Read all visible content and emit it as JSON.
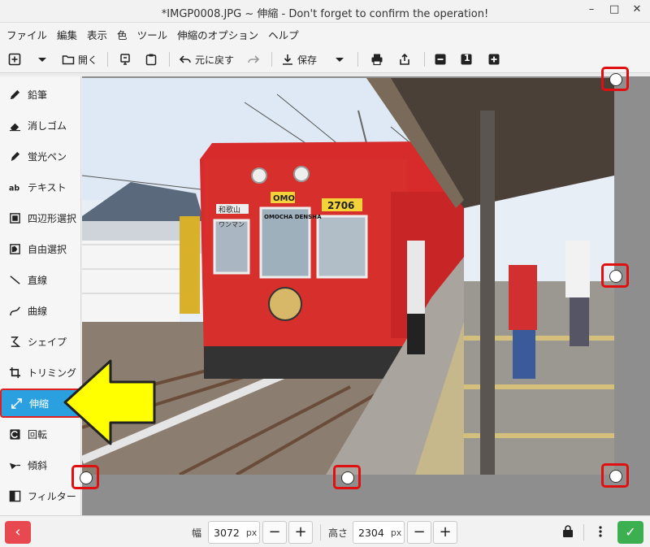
{
  "window": {
    "title": "*IMGP0008.JPG ~ 伸縮 - Don't forget to confirm the operation!"
  },
  "menu": [
    "ファイル",
    "編集",
    "表示",
    "色",
    "ツール",
    "伸縮のオプション",
    "ヘルプ"
  ],
  "toolbar": {
    "open_label": "開く",
    "undo_label": "元に戻す",
    "save_label": "保存",
    "zoom_value": "1"
  },
  "tools": [
    {
      "label": "鉛筆",
      "icon": "pencil-icon"
    },
    {
      "label": "消しゴム",
      "icon": "eraser-icon"
    },
    {
      "label": "蛍光ペン",
      "icon": "highlighter-icon"
    },
    {
      "label": "テキスト",
      "icon": "text-icon"
    },
    {
      "label": "四辺形選択",
      "icon": "rect-select-icon"
    },
    {
      "label": "自由選択",
      "icon": "free-select-icon"
    },
    {
      "label": "直線",
      "icon": "line-icon"
    },
    {
      "label": "曲線",
      "icon": "curve-icon"
    },
    {
      "label": "シェイプ",
      "icon": "shape-icon"
    },
    {
      "label": "トリミング",
      "icon": "crop-icon"
    },
    {
      "label": "伸縮",
      "icon": "scale-icon",
      "active": true
    },
    {
      "label": "回転",
      "icon": "rotate-icon"
    },
    {
      "label": "傾斜",
      "icon": "skew-icon"
    },
    {
      "label": "フィルター",
      "icon": "filter-icon"
    }
  ],
  "photo": {
    "train_label": "OMO",
    "train_number": "2706",
    "destination": "和歌山",
    "service": "ワンマン",
    "name_plate": "OMOCHA DENSHA"
  },
  "bottom": {
    "width_label": "幅",
    "width_value": "3072",
    "height_label": "高さ",
    "height_value": "2304",
    "unit": "px",
    "minus": "−",
    "plus": "+"
  },
  "colors": {
    "accent": "#2aa0e0",
    "highlight": "#e02020",
    "apply": "#3cb050",
    "cancel": "#e8484f",
    "arrow": "#ffff00"
  }
}
